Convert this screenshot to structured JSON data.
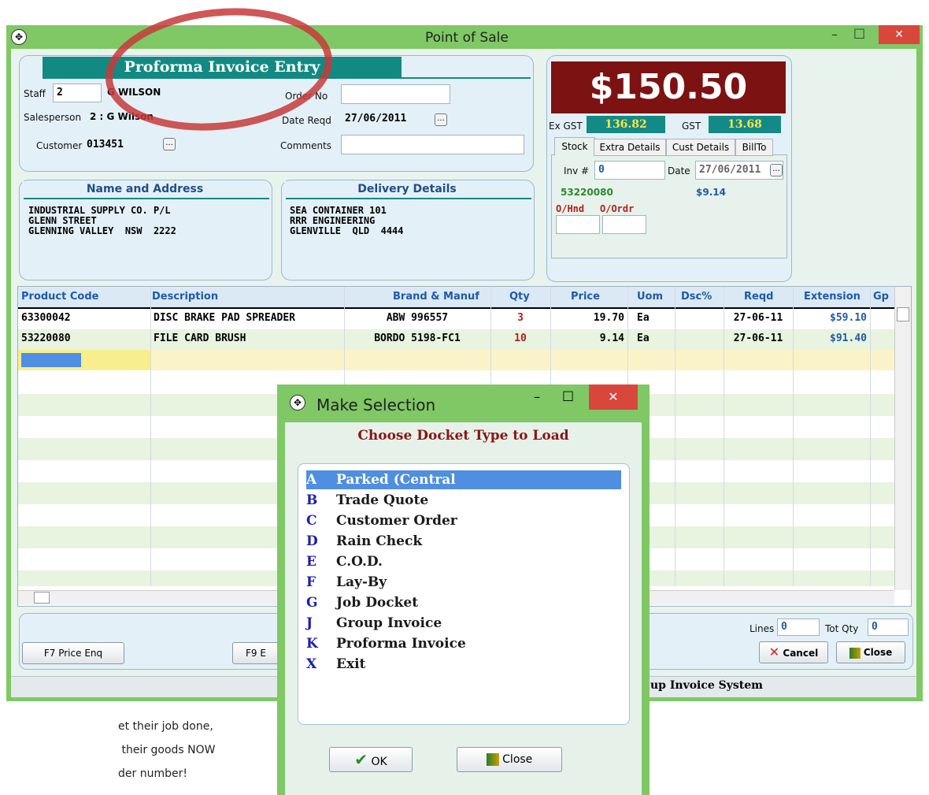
{
  "window": {
    "title": "Point of Sale",
    "min_label": "–",
    "max_label": "□",
    "close_label": "✕"
  },
  "form": {
    "heading": "Proforma Invoice Entry",
    "staff_label": "Staff",
    "staff_value": "2",
    "staff_name": "G WILSON",
    "salesperson_label": "Salesperson",
    "salesperson_value": "2 : G Wilson",
    "customer_label": "Customer",
    "customer_value": "013451",
    "order_label": "Order No",
    "order_value": "",
    "date_reqd_label": "Date Reqd",
    "date_reqd_value": "27/06/2011",
    "comments_label": "Comments",
    "comments_value": "",
    "dots": "..."
  },
  "name_address": {
    "heading": "Name and Address",
    "text": "INDUSTRIAL SUPPLY CO. P/L\nGLENN STREET\nGLENNING VALLEY  NSW  2222"
  },
  "delivery": {
    "heading": "Delivery Details",
    "text": "SEA CONTAINER 101\nRRR ENGINEERING\nGLENVILLE  QLD  4444"
  },
  "totals": {
    "total": "$150.50",
    "ex_gst_label": "Ex GST",
    "ex_gst_value": "136.82",
    "gst_label": "GST",
    "gst_value": "13.68"
  },
  "tabs": [
    "Stock",
    "Extra Details",
    "Cust Details",
    "BillTo"
  ],
  "stock": {
    "inv_label": "Inv #",
    "inv_value": "0",
    "date_label": "Date",
    "date_value": "27/06/2011",
    "code": "53220080",
    "price": "$9.14",
    "on_hand_label": "O/Hnd",
    "on_order_label": "O/Ordr"
  },
  "grid": {
    "columns": [
      "Product Code",
      "Description",
      "Brand & Manuf",
      "Qty",
      "Price",
      "Uom",
      "Dsc%",
      "Reqd",
      "Extension",
      "Gp"
    ],
    "rows": [
      [
        "63300042",
        "DISC BRAKE PAD SPREADER",
        "ABW 996557",
        "3",
        "19.70",
        "Ea",
        "",
        "27-06-11",
        "$59.10"
      ],
      [
        "53220080",
        "FILE CARD BRUSH",
        "BORDO 5198-FC1",
        "10",
        "9.14",
        "Ea",
        "",
        "27-06-11",
        "$91.40"
      ]
    ]
  },
  "footer": {
    "lines_label": "Lines",
    "lines_value": "0",
    "totqty_label": "Tot Qty",
    "totqty_value": "0",
    "f7": "F7 Price Enq",
    "f9": "F9 E",
    "cancel": "Cancel",
    "close": "Close",
    "status": "up Invoice System"
  },
  "dialog": {
    "title": "Make Selection",
    "heading": "Choose Docket Type to Load",
    "items": [
      {
        "key": "A",
        "label": "Parked (Central"
      },
      {
        "key": "B",
        "label": "Trade Quote"
      },
      {
        "key": "C",
        "label": "Customer Order"
      },
      {
        "key": "D",
        "label": "Rain Check"
      },
      {
        "key": "E",
        "label": "C.O.D."
      },
      {
        "key": "F",
        "label": "Lay-By"
      },
      {
        "key": "G",
        "label": "Job Docket"
      },
      {
        "key": "J",
        "label": "Group Invoice"
      },
      {
        "key": "K",
        "label": "Proforma Invoice"
      },
      {
        "key": "X",
        "label": "Exit"
      }
    ],
    "ok": "OK",
    "close": "Close"
  },
  "caption": [
    "et their job done,",
    " their goods NOW",
    "der number!"
  ],
  "colors": {
    "window_green": "#7fc865",
    "total_bg": "#7d1212",
    "gst_bg": "#138a86",
    "selection_blue": "#4f8ee0"
  }
}
